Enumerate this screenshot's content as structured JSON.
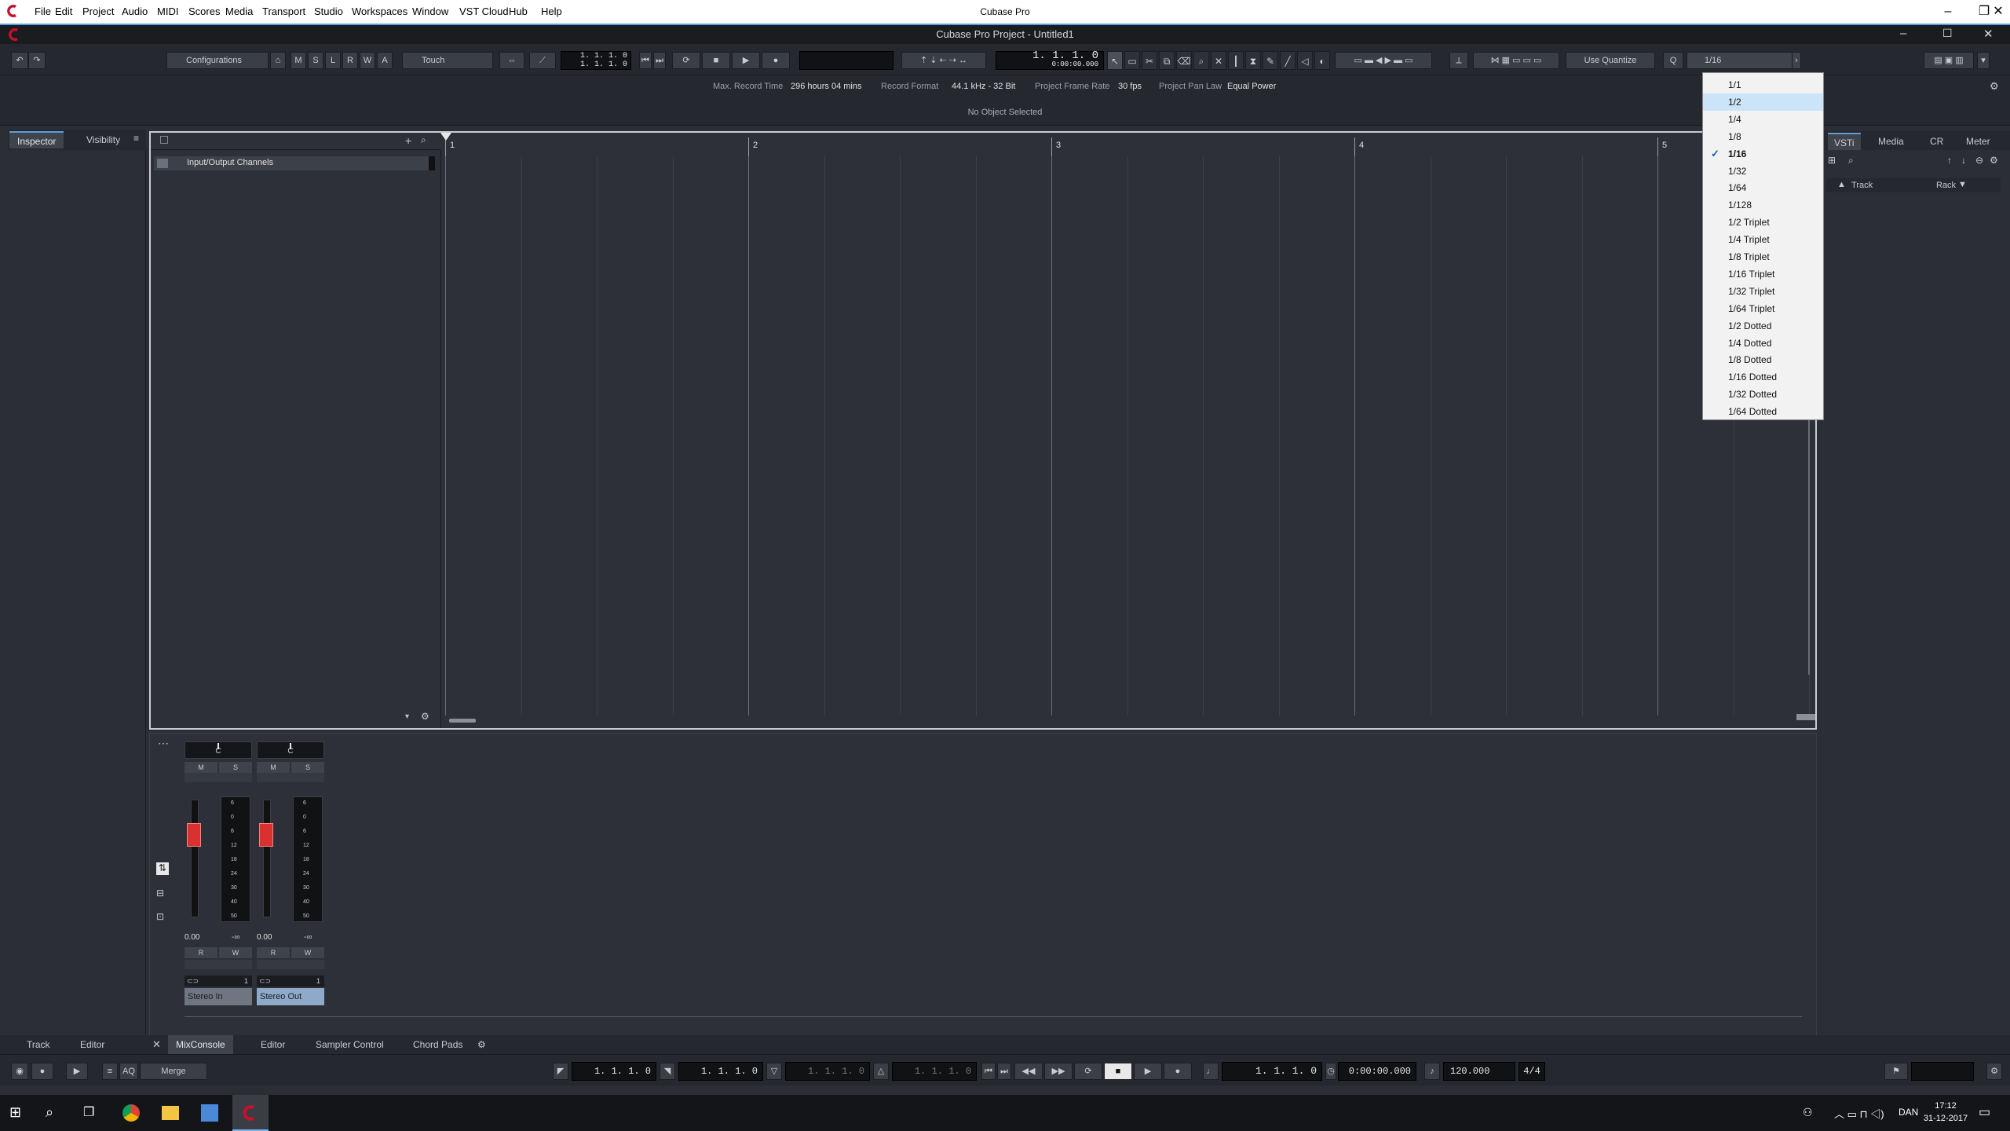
{
  "app": {
    "title": "Cubase Pro",
    "menu": [
      "File",
      "Edit",
      "Project",
      "Audio",
      "MIDI",
      "Scores",
      "Media",
      "Transport",
      "Studio",
      "Workspaces",
      "Window",
      "VST Cloud",
      "Hub",
      "Help"
    ]
  },
  "project": {
    "window_title": "Cubase Pro Project - Untitled1"
  },
  "toolbar": {
    "configurations": "Configurations",
    "msl": [
      "M",
      "S",
      "L",
      "R",
      "W",
      "A"
    ],
    "automation_mode": "Touch",
    "pos1": "1. 1. 1.  0",
    "pos2": "1. 1. 1.  0",
    "main_pos": "1.  1.  1.   0",
    "main_time": "0:00:00.000",
    "use_quantize": "Use Quantize",
    "quantize_value": "1/16"
  },
  "info": {
    "max_record_time_label": "Max. Record Time",
    "max_record_time": "296 hours 04 mins",
    "record_format_label": "Record Format",
    "record_format": "44.1 kHz - 32 Bit",
    "frame_rate_label": "Project Frame Rate",
    "frame_rate": "30 fps",
    "pan_law_label": "Project Pan Law",
    "pan_law": "Equal Power",
    "no_object": "No Object Selected"
  },
  "left_tabs": [
    "Inspector",
    "Visibility"
  ],
  "tracklist": {
    "folder": "Input/Output Channels"
  },
  "ruler": {
    "bars": [
      "1",
      "2",
      "3",
      "4",
      "5"
    ]
  },
  "right_tabs": [
    "VSTi",
    "Media",
    "CR",
    "Meter"
  ],
  "rack": {
    "track": "Track",
    "rack": "Rack"
  },
  "mixer": {
    "channels": [
      {
        "name": "Stereo In",
        "pan": "C",
        "volume": "0.00",
        "peak": "-∞",
        "m": "M",
        "s": "S",
        "r": "R",
        "w": "W",
        "num": "1"
      },
      {
        "name": "Stereo Out",
        "pan": "C",
        "volume": "0.00",
        "peak": "-∞",
        "m": "M",
        "s": "S",
        "r": "R",
        "w": "W",
        "num": "1"
      }
    ],
    "scale": [
      "6",
      "0",
      "6",
      "12",
      "18",
      "24",
      "30",
      "40",
      "50"
    ]
  },
  "bottom_tabs": {
    "left": [
      "Track",
      "Editor"
    ],
    "right": [
      "MixConsole",
      "Editor",
      "Sampler Control",
      "Chord Pads"
    ]
  },
  "transport": {
    "aq": "AQ",
    "merge": "Merge",
    "loc_a": "1. 1. 1.   0",
    "loc_b": "1. 1. 1.   0",
    "loc_c": "1. 1. 1.   0",
    "loc_d": "1. 1. 1.   0",
    "pos": "1.  1.  1.   0",
    "time": "0:00:00.000",
    "tempo": "120.000",
    "signature": "4/4"
  },
  "quantize_menu": {
    "options": [
      "1/1",
      "1/2",
      "1/4",
      "1/8",
      "1/16",
      "1/32",
      "1/64",
      "1/128",
      "1/2  Triplet",
      "1/4  Triplet",
      "1/8  Triplet",
      "1/16  Triplet",
      "1/32  Triplet",
      "1/64  Triplet",
      "1/2  Dotted",
      "1/4  Dotted",
      "1/8  Dotted",
      "1/16  Dotted",
      "1/32  Dotted",
      "1/64  Dotted"
    ]
  },
  "taskbar": {
    "lang": "DAN",
    "time": "17:12",
    "date": "31-12-2017"
  },
  "colors": {
    "accent": "#c8102e",
    "blue": "#5a9ee0",
    "fader": "#d93030"
  }
}
